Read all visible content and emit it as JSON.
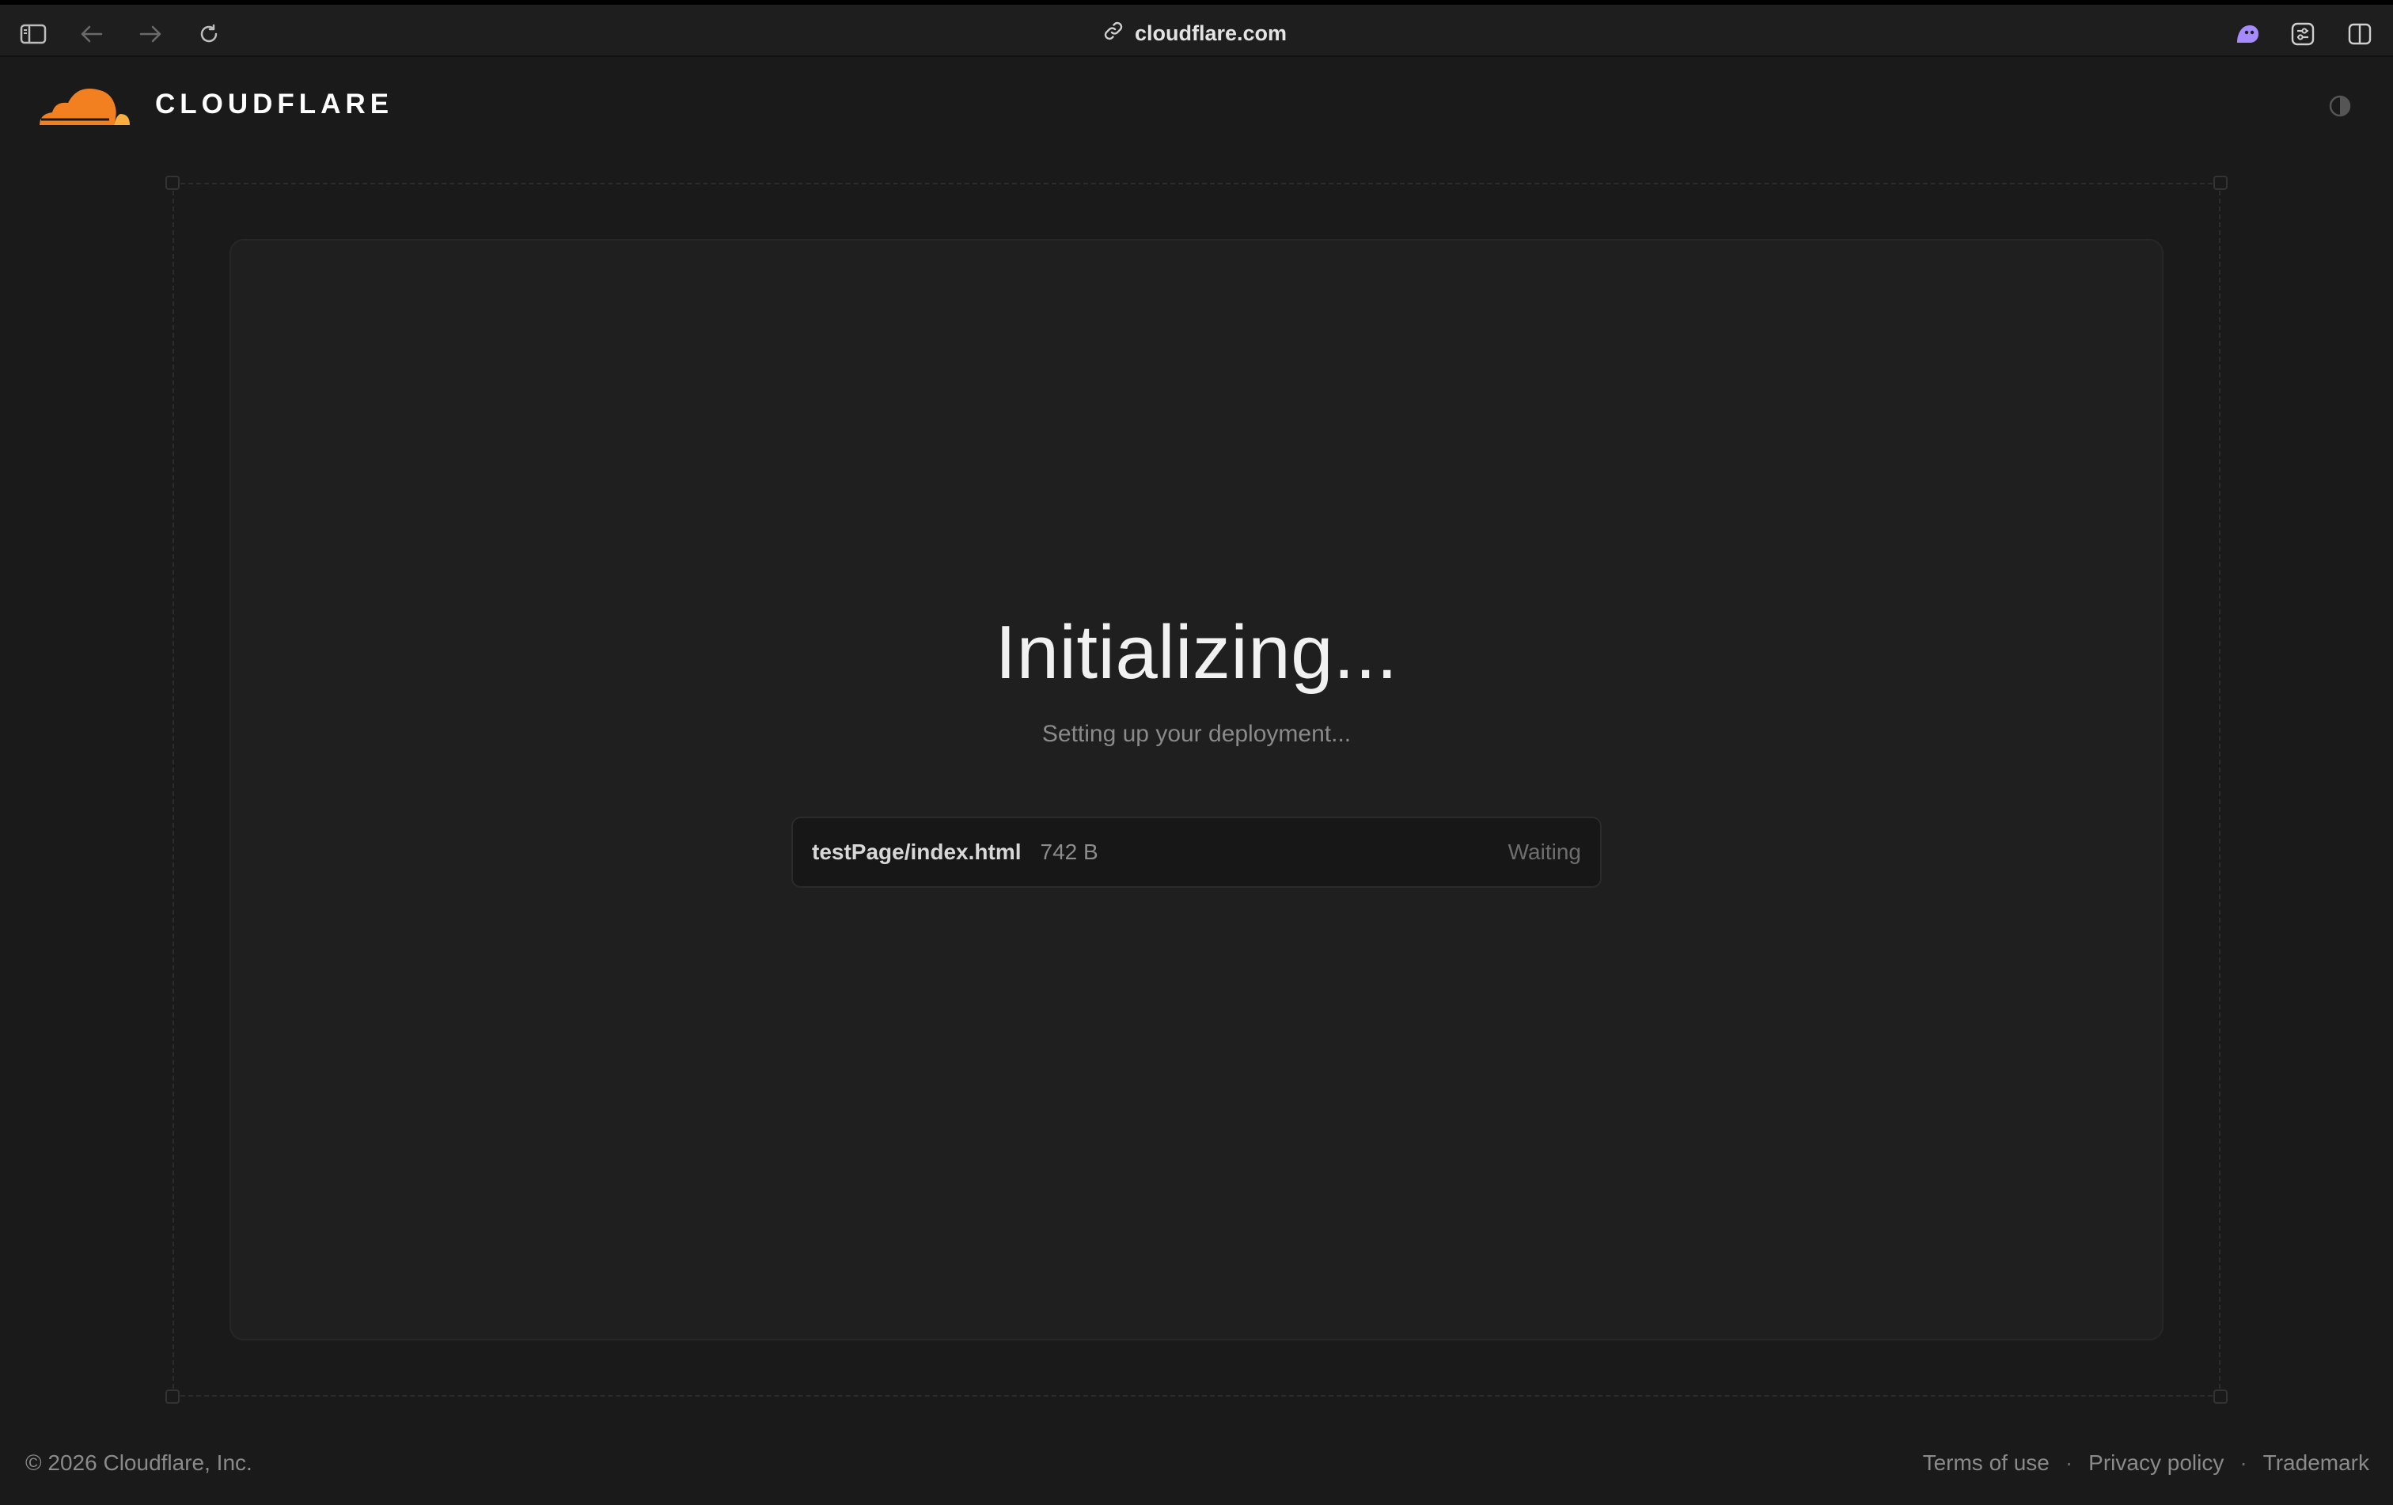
{
  "browser": {
    "url": "cloudflare.com",
    "icons": [
      "sidebar-icon",
      "back-arrow-icon",
      "forward-arrow-icon",
      "reload-icon",
      "link-icon",
      "extension-icon",
      "settings-icon",
      "split-view-icon"
    ]
  },
  "header": {
    "brand": "CLOUDFLARE",
    "theme_icon": "contrast-icon"
  },
  "main": {
    "title": "Initializing...",
    "subtitle": "Setting up your deployment...",
    "file": {
      "name": "testPage/index.html",
      "size": "742 B",
      "status": "Waiting"
    }
  },
  "footer": {
    "copyright": "© 2026 Cloudflare, Inc.",
    "links": [
      "Terms of use",
      "Privacy policy",
      "Trademark"
    ],
    "separator": "·"
  },
  "colors": {
    "background": "#1a1a1a",
    "card": "#1f1f1f",
    "brand_orange": "#f38020",
    "brand_light_orange": "#faae40"
  }
}
